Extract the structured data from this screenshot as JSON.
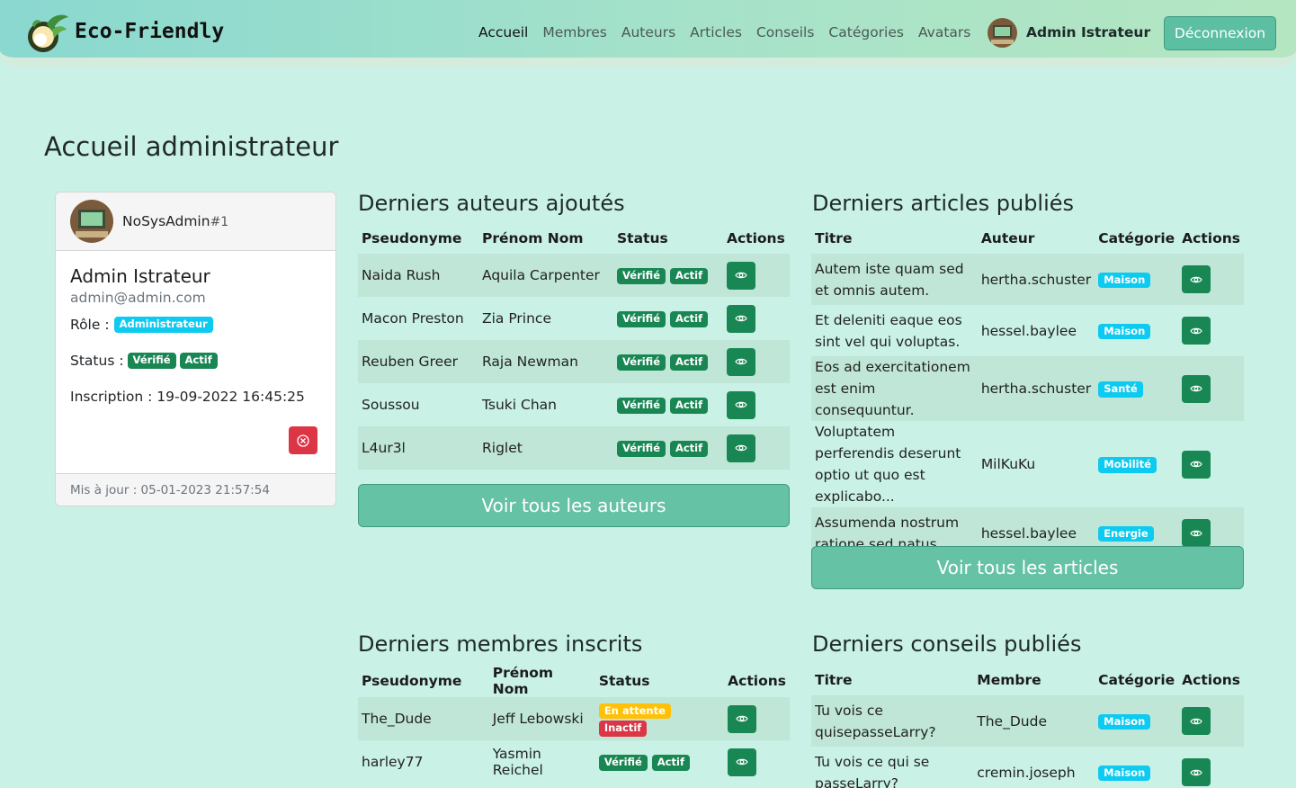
{
  "header": {
    "brand": "Eco-Friendly",
    "nav": [
      "Accueil",
      "Membres",
      "Auteurs",
      "Articles",
      "Conseils",
      "Catégories",
      "Avatars"
    ],
    "user_name": "Admin Istrateur",
    "logout_label": "Déconnexion"
  },
  "page": {
    "title": "Accueil administrateur"
  },
  "profile": {
    "pseudo": "NoSysAdmin",
    "pseudo_num": "#1",
    "name": "Admin Istrateur",
    "email": "admin@admin.com",
    "role_label": "Rôle :",
    "role": "Administrateur",
    "status_label": "Status :",
    "status_verified": "Vérifié",
    "status_active": "Actif",
    "inscription": "Inscription : 19-09-2022 16:45:25",
    "updated": "Mis à jour : 05-01-2023 21:57:54"
  },
  "authors": {
    "title": "Derniers auteurs ajoutés",
    "headers": [
      "Pseudonyme",
      "Prénom Nom",
      "Status",
      "Actions"
    ],
    "rows": [
      {
        "pseudo": "Naida Rush",
        "name": "Aquila Carpenter",
        "s1": "Vérifié",
        "s2": "Actif"
      },
      {
        "pseudo": "Macon Preston",
        "name": "Zia Prince",
        "s1": "Vérifié",
        "s2": "Actif"
      },
      {
        "pseudo": "Reuben Greer",
        "name": "Raja Newman",
        "s1": "Vérifié",
        "s2": "Actif"
      },
      {
        "pseudo": "Soussou",
        "name": "Tsuki Chan",
        "s1": "Vérifié",
        "s2": "Actif"
      },
      {
        "pseudo": "L4ur3l",
        "name": "Riglet",
        "s1": "Vérifié",
        "s2": "Actif"
      }
    ],
    "button": "Voir tous les auteurs"
  },
  "articles": {
    "title": "Derniers articles publiés",
    "headers": [
      "Titre",
      "Auteur",
      "Catégorie",
      "Actions"
    ],
    "rows": [
      {
        "title": "Autem iste quam sed et omnis autem.",
        "author": "hertha.schuster",
        "cat": "Maison"
      },
      {
        "title": "Et deleniti eaque eos sint vel qui voluptas.",
        "author": "hessel.baylee",
        "cat": "Maison"
      },
      {
        "title": "Eos ad exercitationem est enim consequuntur.",
        "author": "hertha.schuster",
        "cat": "Santé"
      },
      {
        "title": "Voluptatem perferendis deserunt optio ut quo est explicabo...",
        "author": "MilKuKu",
        "cat": "Mobilité"
      },
      {
        "title": "Assumenda nostrum ratione sed natus.",
        "author": "hessel.baylee",
        "cat": "Energie"
      }
    ],
    "button": "Voir tous les articles"
  },
  "members": {
    "title": "Derniers membres inscrits",
    "headers": [
      "Pseudonyme",
      "Prénom Nom",
      "Status",
      "Actions"
    ],
    "rows": [
      {
        "pseudo": "The_Dude",
        "name": "Jeff Lebowski",
        "s1": "En attente",
        "s2": "Inactif"
      },
      {
        "pseudo": "harley77",
        "name": "Yasmin Reichel",
        "s1": "Vérifié",
        "s2": "Actif"
      }
    ]
  },
  "tips": {
    "title": "Derniers conseils publiés",
    "headers": [
      "Titre",
      "Membre",
      "Catégorie",
      "Actions"
    ],
    "rows": [
      {
        "title": "Tu vois ce quisepasseLarry?",
        "member": "The_Dude",
        "cat": "Maison"
      },
      {
        "title": "Tu vois ce qui se passeLarry?",
        "member": "cremin.joseph",
        "cat": "Maison"
      }
    ]
  }
}
